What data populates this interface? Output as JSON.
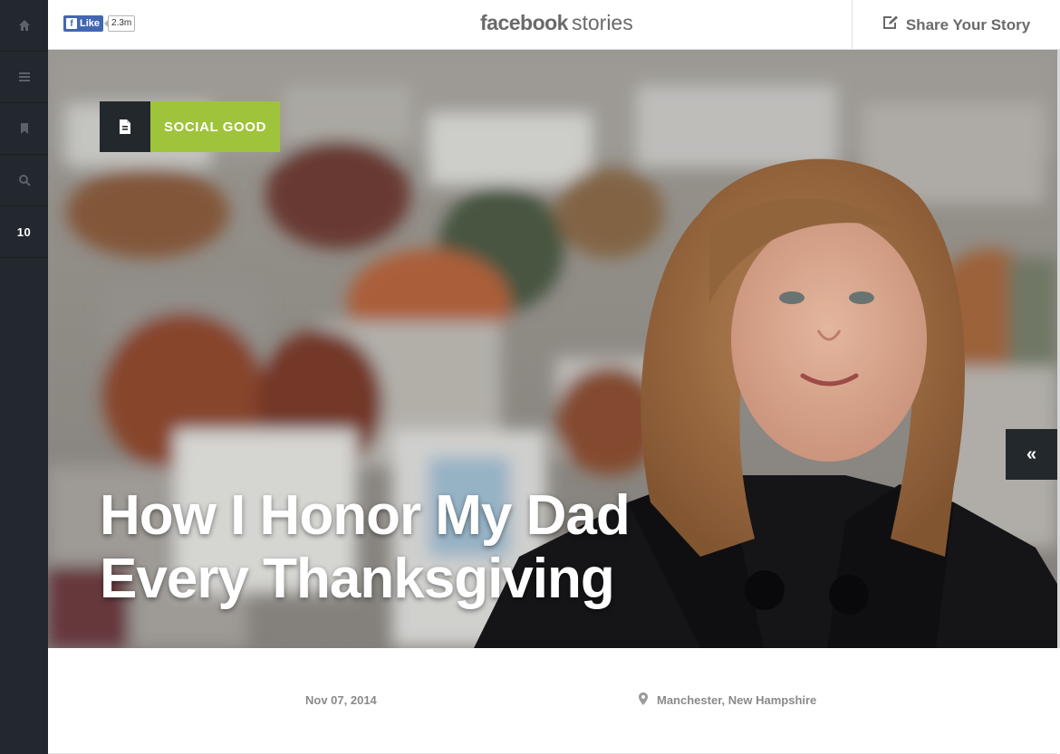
{
  "sidebar": {
    "items": [
      {
        "icon": "home-icon"
      },
      {
        "icon": "menu-icon"
      },
      {
        "icon": "bookmark-icon"
      },
      {
        "icon": "search-icon"
      }
    ],
    "count": "10"
  },
  "topbar": {
    "like_label": "Like",
    "like_count": "2.3m",
    "brand_bold": "facebook",
    "brand_light": "stories",
    "share_label": "Share Your Story"
  },
  "hero": {
    "category_icon": "document-icon",
    "category": "SOCIAL GOOD",
    "headline_line1": "How I Honor My Dad",
    "headline_line2": "Every Thanksgiving",
    "collapse_label": "«"
  },
  "meta": {
    "date": "Nov 07, 2014",
    "location": "Manchester, New Hampshire"
  },
  "colors": {
    "sidebar_bg": "#22282d",
    "accent_green": "#9fc33b",
    "fb_blue": "#4267b2",
    "muted_text": "#8a8a8a"
  }
}
